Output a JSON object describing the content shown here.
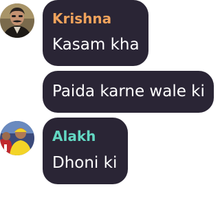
{
  "messages": [
    {
      "sender": "Krishna",
      "sender_color": "#f0a35c",
      "text": "Kasam kha",
      "avatar": "man-with-mustache-avatar"
    },
    {
      "sender": "",
      "text": "Paida karne wale ki"
    },
    {
      "sender": "Alakh",
      "sender_color": "#63d8c3",
      "text": "Dhoni ki",
      "avatar": "cricket-players-avatar"
    }
  ],
  "colors": {
    "bubble_bg": "#2a2535",
    "message_text": "#ffffff",
    "page_bg": "#ffffff"
  }
}
